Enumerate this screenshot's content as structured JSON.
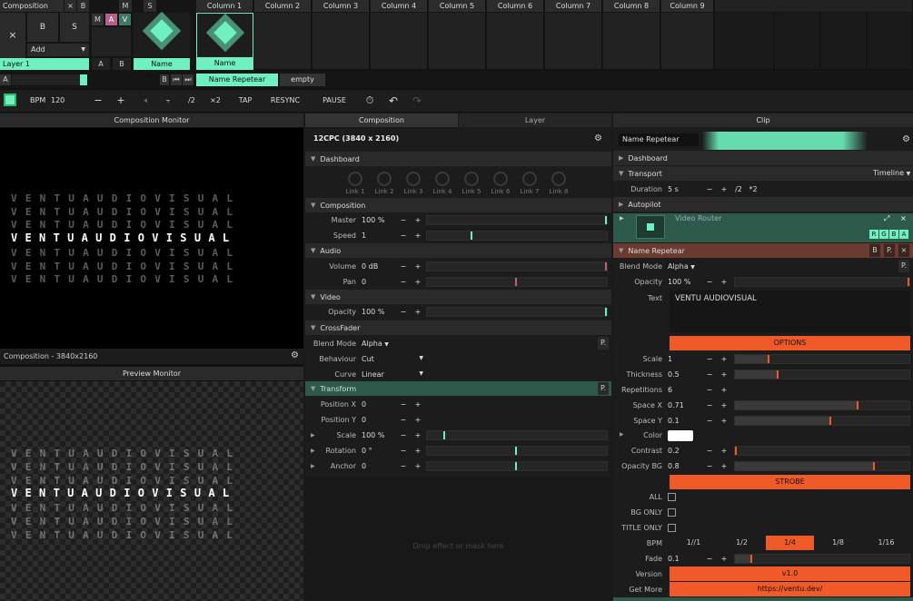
{
  "top": {
    "composition": "Composition",
    "x": "×",
    "b": "B",
    "x_btn": "×",
    "b_btn": "B",
    "s_btn": "S",
    "add": "Add",
    "m": "M",
    "a": "A",
    "v": "V",
    "m2": "M",
    "s2": "S",
    "layer1": "Layer 1",
    "a_lbl": "A",
    "b_lbl": "B",
    "a2": "A",
    "b2": "B",
    "name_repetear": "Name Repetear",
    "name_repetear2": "Name Repetear",
    "name_repetear3": "Name Repetear",
    "empty": "empty",
    "a3": "A",
    "b3": "B",
    "play_prev": "⏮",
    "play_next": "⏭"
  },
  "columns": [
    "Column 1",
    "Column 2",
    "Column 3",
    "Column 4",
    "Column 5",
    "Column 6",
    "Column 7",
    "Column 8",
    "Column 9"
  ],
  "toolbar": {
    "bpm_label": "BPM",
    "bpm": "120",
    "minus": "−",
    "plus": "+",
    "nudge_l": "⫞",
    "nudge_r": "⫟",
    "half": "/2",
    "double": "×2",
    "tap": "TAP",
    "resync": "RESYNC",
    "pause": "PAUSE"
  },
  "left": {
    "comp_monitor": "Composition Monitor",
    "comp_info": "Composition - 3840x2160",
    "preview_monitor": "Preview Monitor",
    "headline": "VENTUAUDIOVISUAL",
    "ghost": "VENTUAUDIOVISUAL"
  },
  "mid": {
    "tab_composition": "Composition",
    "tab_layer": "Layer",
    "title": "12CPC (3840 x 2160)",
    "dashboard": "Dashboard",
    "links": [
      "Link 1",
      "Link 2",
      "Link 3",
      "Link 4",
      "Link 5",
      "Link 6",
      "Link 7",
      "Link 8"
    ],
    "composition": "Composition",
    "master_lbl": "Master",
    "master_val": "100 %",
    "speed_lbl": "Speed",
    "speed_val": "1",
    "audio": "Audio",
    "volume_lbl": "Volume",
    "volume_val": "0 dB",
    "pan_lbl": "Pan",
    "pan_val": "0",
    "video": "Video",
    "opacity_lbl": "Opacity",
    "opacity_val": "100 %",
    "crossfader": "CrossFader",
    "blend_lbl": "Blend Mode",
    "blend_val": "Alpha",
    "behaviour_lbl": "Behaviour",
    "behaviour_val": "Cut",
    "curve_lbl": "Curve",
    "curve_val": "Linear",
    "transform": "Transform",
    "posx_lbl": "Position X",
    "posx_val": "0",
    "posy_lbl": "Position Y",
    "posy_val": "0",
    "scale_lbl": "Scale",
    "scale_val": "100 %",
    "rotation_lbl": "Rotation",
    "rotation_val": "0 °",
    "anchor_lbl": "Anchor",
    "anchor_val": "0",
    "drop": "Drop effect or mask here",
    "p": "P."
  },
  "right": {
    "clip": "Clip",
    "name": "Name Repetear",
    "dashboard": "Dashboard",
    "transport": "Transport",
    "timeline": "Timeline",
    "duration_lbl": "Duration",
    "duration_val": "5 s",
    "half": "/2",
    "double": "*2",
    "autopilot": "Autopilot",
    "video_router": "Video Router",
    "rgba": [
      "R",
      "G",
      "B",
      "A"
    ],
    "effect_name": "Name Repetear",
    "b": "B",
    "p": "P.",
    "x": "×",
    "blend_lbl": "Blend Mode",
    "blend_val": "Alpha",
    "opacity_lbl": "Opacity",
    "opacity_val": "100 %",
    "text_lbl": "Text",
    "text_val": "VENTU AUDIOVISUAL",
    "options": "OPTIONS",
    "scale_lbl": "Scale",
    "scale_val": "1",
    "thickness_lbl": "Thickness",
    "thickness_val": "0.5",
    "reps_lbl": "Repetitions",
    "reps_val": "6",
    "spacex_lbl": "Space X",
    "spacex_val": "0.71",
    "spacey_lbl": "Space Y",
    "spacey_val": "0.1",
    "color_lbl": "Color",
    "contrast_lbl": "Contrast",
    "contrast_val": "0.2",
    "opbg_lbl": "Opacity BG",
    "opbg_val": "0.8",
    "strobe": "STROBE",
    "all": "ALL",
    "bg_only": "BG ONLY",
    "title_only": "TITLE ONLY",
    "bpm_lbl": "BPM",
    "bpm_opts": [
      "1//1",
      "1/2",
      "1/4",
      "1/8",
      "1/16"
    ],
    "fade_lbl": "Fade",
    "fade_val": "0.1",
    "version_lbl": "Version",
    "version_val": "v1.0",
    "getmore_lbl": "Get More",
    "getmore_val": "https://ventu.dev/"
  },
  "colors": {
    "accent": "#6ef0c0",
    "orange": "#f05a28"
  },
  "values": {
    "master": 1.0,
    "speed": 0.25,
    "volume": 1.0,
    "pan": 0.5,
    "opacity": 1.0,
    "scale": 0.1,
    "rotation": 0.5,
    "anchor": 0.5,
    "clip_opacity": 1.0,
    "fx_scale": 0.2,
    "thickness": 0.25,
    "spacex": 0.71,
    "spacey": 0.55,
    "contrast": 0.01,
    "opbg": 0.8,
    "fade": 0.1
  }
}
